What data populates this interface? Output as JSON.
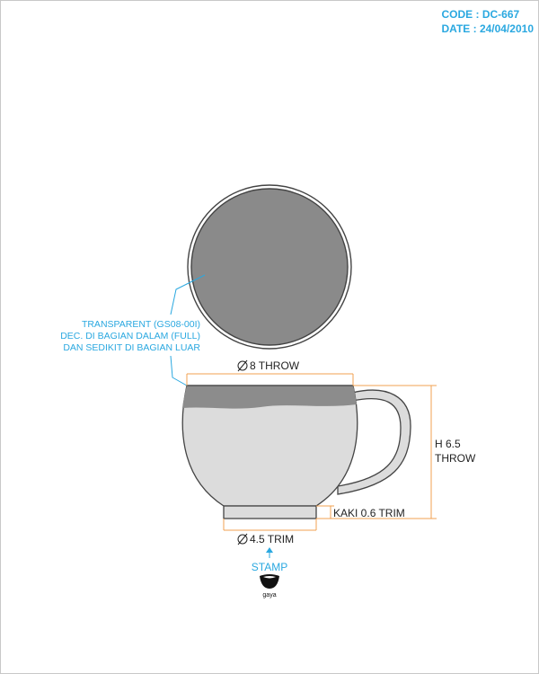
{
  "header": {
    "code": "CODE : DC-667",
    "date": "DATE : 24/04/2010"
  },
  "annotation": {
    "lines": [
      "TRANSPARENT (GS08-00I)",
      "DEC. DI BAGIAN DALAM (FULL)",
      "DAN SEDIKIT DI BAGIAN LUAR"
    ]
  },
  "dimensions": {
    "top_diameter": "8 THROW",
    "height_line1": "H 6.5",
    "height_line2": "THROW",
    "foot": "KAKI 0.6 TRIM",
    "base_diameter": "4.5 TRIM"
  },
  "stamp": {
    "label": "STAMP",
    "logo_text": "gaya"
  },
  "colors": {
    "accent": "#2aa8e0",
    "dimension": "#f0a050",
    "body_fill": "#dcdcdc",
    "glaze_dark": "#8c8c8c",
    "plate_fill": "#8a8a8a",
    "outline": "#444444"
  }
}
